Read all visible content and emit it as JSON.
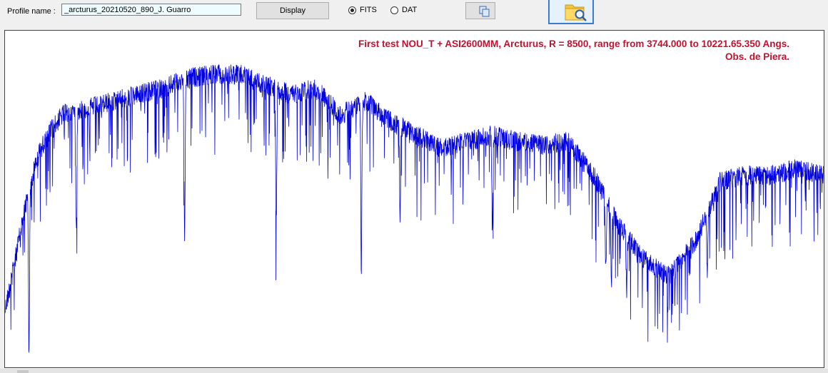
{
  "toolbar": {
    "profile_label": "Profile name :",
    "profile_value": "_arcturus_20210520_890_J. Guarro",
    "display_label": "Display",
    "format_options": [
      "FITS",
      "DAT"
    ],
    "format_selected": "FITS",
    "copy_icon": "copy-icon",
    "open_icon": "folder-search-icon"
  },
  "plot": {
    "title_line1": "First test  NOU_T + ASI2600MM,  Arcturus,  R =  8500, range from 3744.000 to 10221.65.350 Angs.",
    "title_line2": "Obs. de Piera.",
    "line_color": "#0000e0",
    "title_color": "#c8102e"
  },
  "chart_data": {
    "type": "line",
    "title": "First test  NOU_T + ASI2600MM,  Arcturus,  R =  8500, range from 3744.000 to 10221.65.350 Angs.",
    "subtitle": "Obs. de Piera.",
    "xlabel": "",
    "ylabel": "",
    "xlim": [
      3744.0,
      10221.65
    ],
    "ylim": [
      0,
      1
    ],
    "grid": false,
    "continuum_x": [
      3744,
      3800,
      3900,
      4000,
      4100,
      4200,
      4400,
      4600,
      4800,
      5000,
      5200,
      5400,
      5600,
      5800,
      6000,
      6200,
      6400,
      6600,
      6800,
      7000,
      7200,
      7400,
      7600,
      7800,
      8000,
      8200,
      8400,
      8600,
      8800,
      9000,
      9200,
      9400,
      9600,
      9800,
      10000,
      10221
    ],
    "continuum_y": [
      0.2,
      0.3,
      0.5,
      0.66,
      0.73,
      0.78,
      0.8,
      0.82,
      0.84,
      0.86,
      0.89,
      0.9,
      0.9,
      0.87,
      0.84,
      0.86,
      0.78,
      0.82,
      0.76,
      0.72,
      0.68,
      0.7,
      0.72,
      0.7,
      0.69,
      0.7,
      0.6,
      0.45,
      0.35,
      0.3,
      0.4,
      0.58,
      0.6,
      0.6,
      0.62,
      0.6
    ],
    "absorption_lines": [
      {
        "x": 3934,
        "depth": 0.85
      },
      {
        "x": 4308,
        "depth": 0.45
      },
      {
        "x": 5165,
        "depth": 0.55
      },
      {
        "x": 5890,
        "depth": 0.45
      },
      {
        "x": 6563,
        "depth": 0.6
      },
      {
        "x": 6870,
        "depth": 0.35
      },
      {
        "x": 7600,
        "depth": 0.4
      },
      {
        "x": 8498,
        "depth": 0.4
      },
      {
        "x": 8542,
        "depth": 0.45
      },
      {
        "x": 8662,
        "depth": 0.4
      },
      {
        "x": 9300,
        "depth": 0.35
      }
    ]
  }
}
